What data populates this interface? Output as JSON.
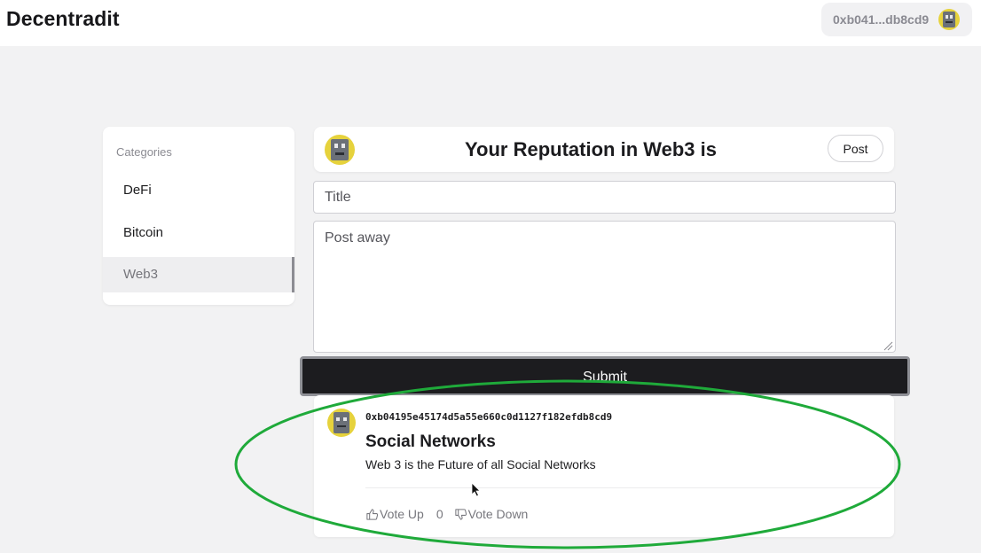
{
  "header": {
    "brand": "Decentradit",
    "wallet_address": "0xb041...db8cd9",
    "wallet_avatar_icon": "identicon-avatar"
  },
  "sidebar": {
    "title": "Categories",
    "items": [
      {
        "label": "DeFi",
        "active": false
      },
      {
        "label": "Bitcoin",
        "active": false
      },
      {
        "label": "Web3",
        "active": true
      }
    ]
  },
  "reputation": {
    "text": "Your Reputation in Web3 is",
    "post_button": "Post",
    "avatar_icon": "identicon-avatar"
  },
  "composer": {
    "title_placeholder": "Title",
    "body_placeholder": "Post away",
    "submit_label": "Submit"
  },
  "posts": [
    {
      "author": "0xb04195e45174d5a55e660c0d1127f182efdb8cd9",
      "title": "Social Networks",
      "body": "Web 3 is the Future of all Social Networks",
      "vote_up_label": "Vote Up",
      "vote_count": "0",
      "vote_down_label": "Vote Down",
      "avatar_icon": "identicon-avatar"
    }
  ],
  "colors": {
    "background": "#f2f2f3",
    "submit_button": "#1c1c1f",
    "annotation_ellipse": "#1faa3a",
    "avatar_yellow": "#e6d23c"
  }
}
